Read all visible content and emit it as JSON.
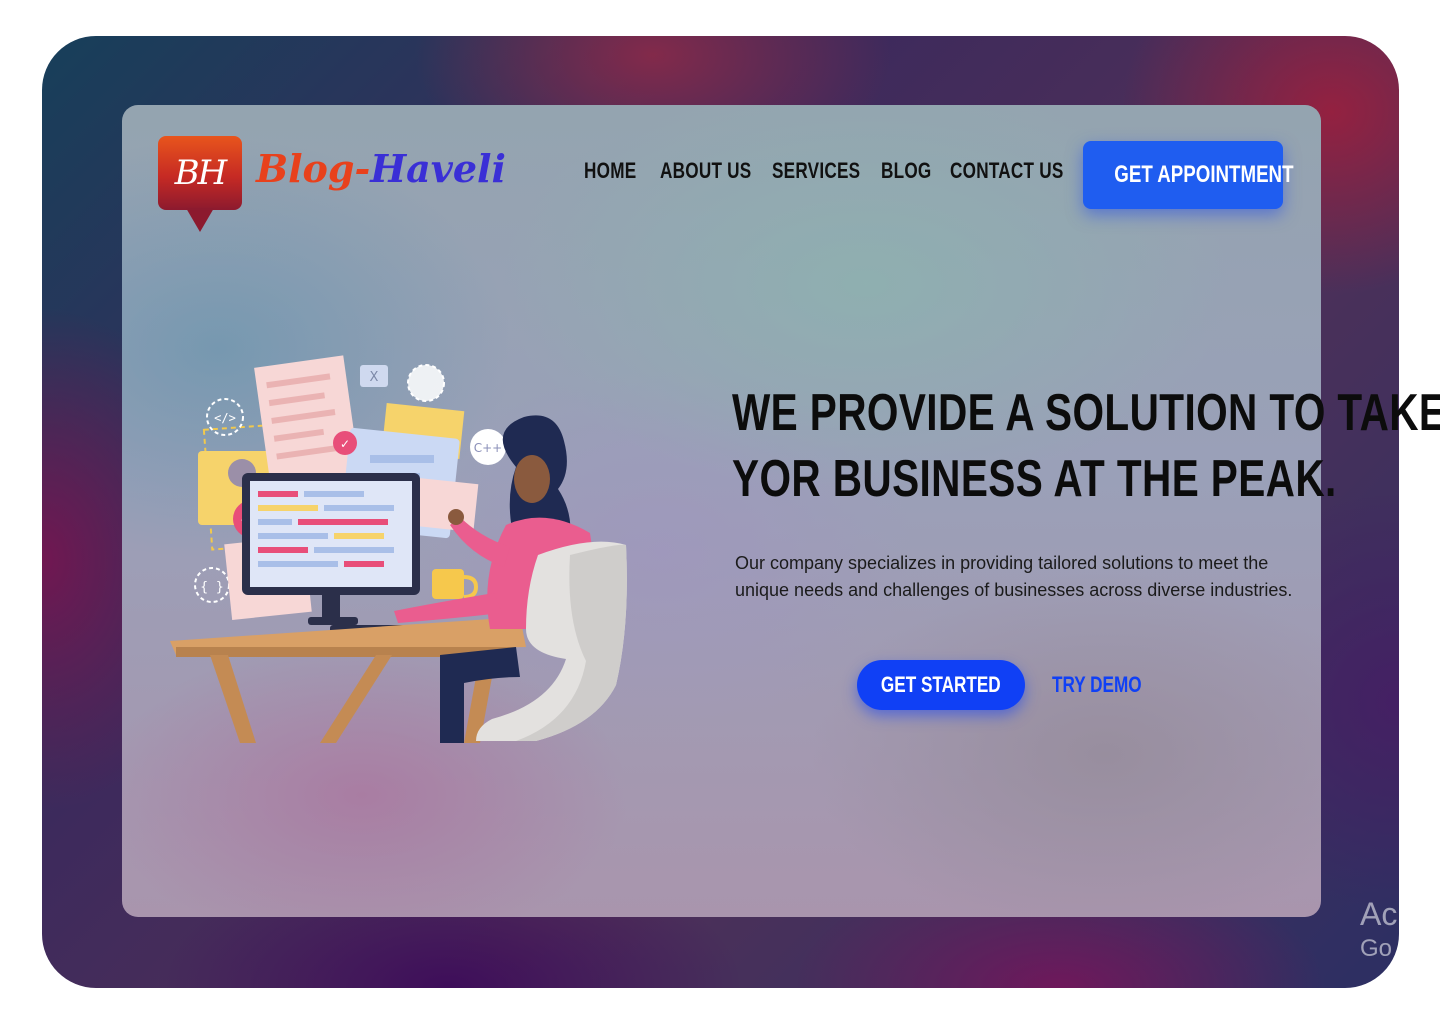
{
  "brand": {
    "badge_text": "BH",
    "name_part1": "Blog-",
    "name_part2": "Haveli",
    "colors": {
      "badge": "#c62a24",
      "name_primary": "#e8411c",
      "name_accent": "#3a2fd6"
    }
  },
  "nav": {
    "items": [
      {
        "label": "HOME"
      },
      {
        "label": "ABOUT US"
      },
      {
        "label": "SERVICES"
      },
      {
        "label": "BLOG"
      },
      {
        "label": "CONTACT US"
      }
    ]
  },
  "header": {
    "cta_label": "GET APPOINTMENT"
  },
  "hero": {
    "title_line1": "WE PROVIDE A SOLUTION TO TAKE",
    "title_line2": "YOR BUSINESS AT THE PEAK.",
    "description": "Our company specializes in providing tailored solutions to meet the unique needs and challenges of businesses across diverse industries.",
    "primary_button": "GET STARTED",
    "secondary_link": "TRY DEMO",
    "illustration": {
      "name": "developer-at-desk-illustration",
      "code_badge": "</>",
      "braces_badge": "{ }",
      "cpp_badge": "C++",
      "close_badge": "X"
    }
  },
  "os_overlay": {
    "line1": "Ac",
    "line2": "Go"
  },
  "theme": {
    "primary_blue": "#1f5df0",
    "title_color": "#0c0c0c"
  }
}
